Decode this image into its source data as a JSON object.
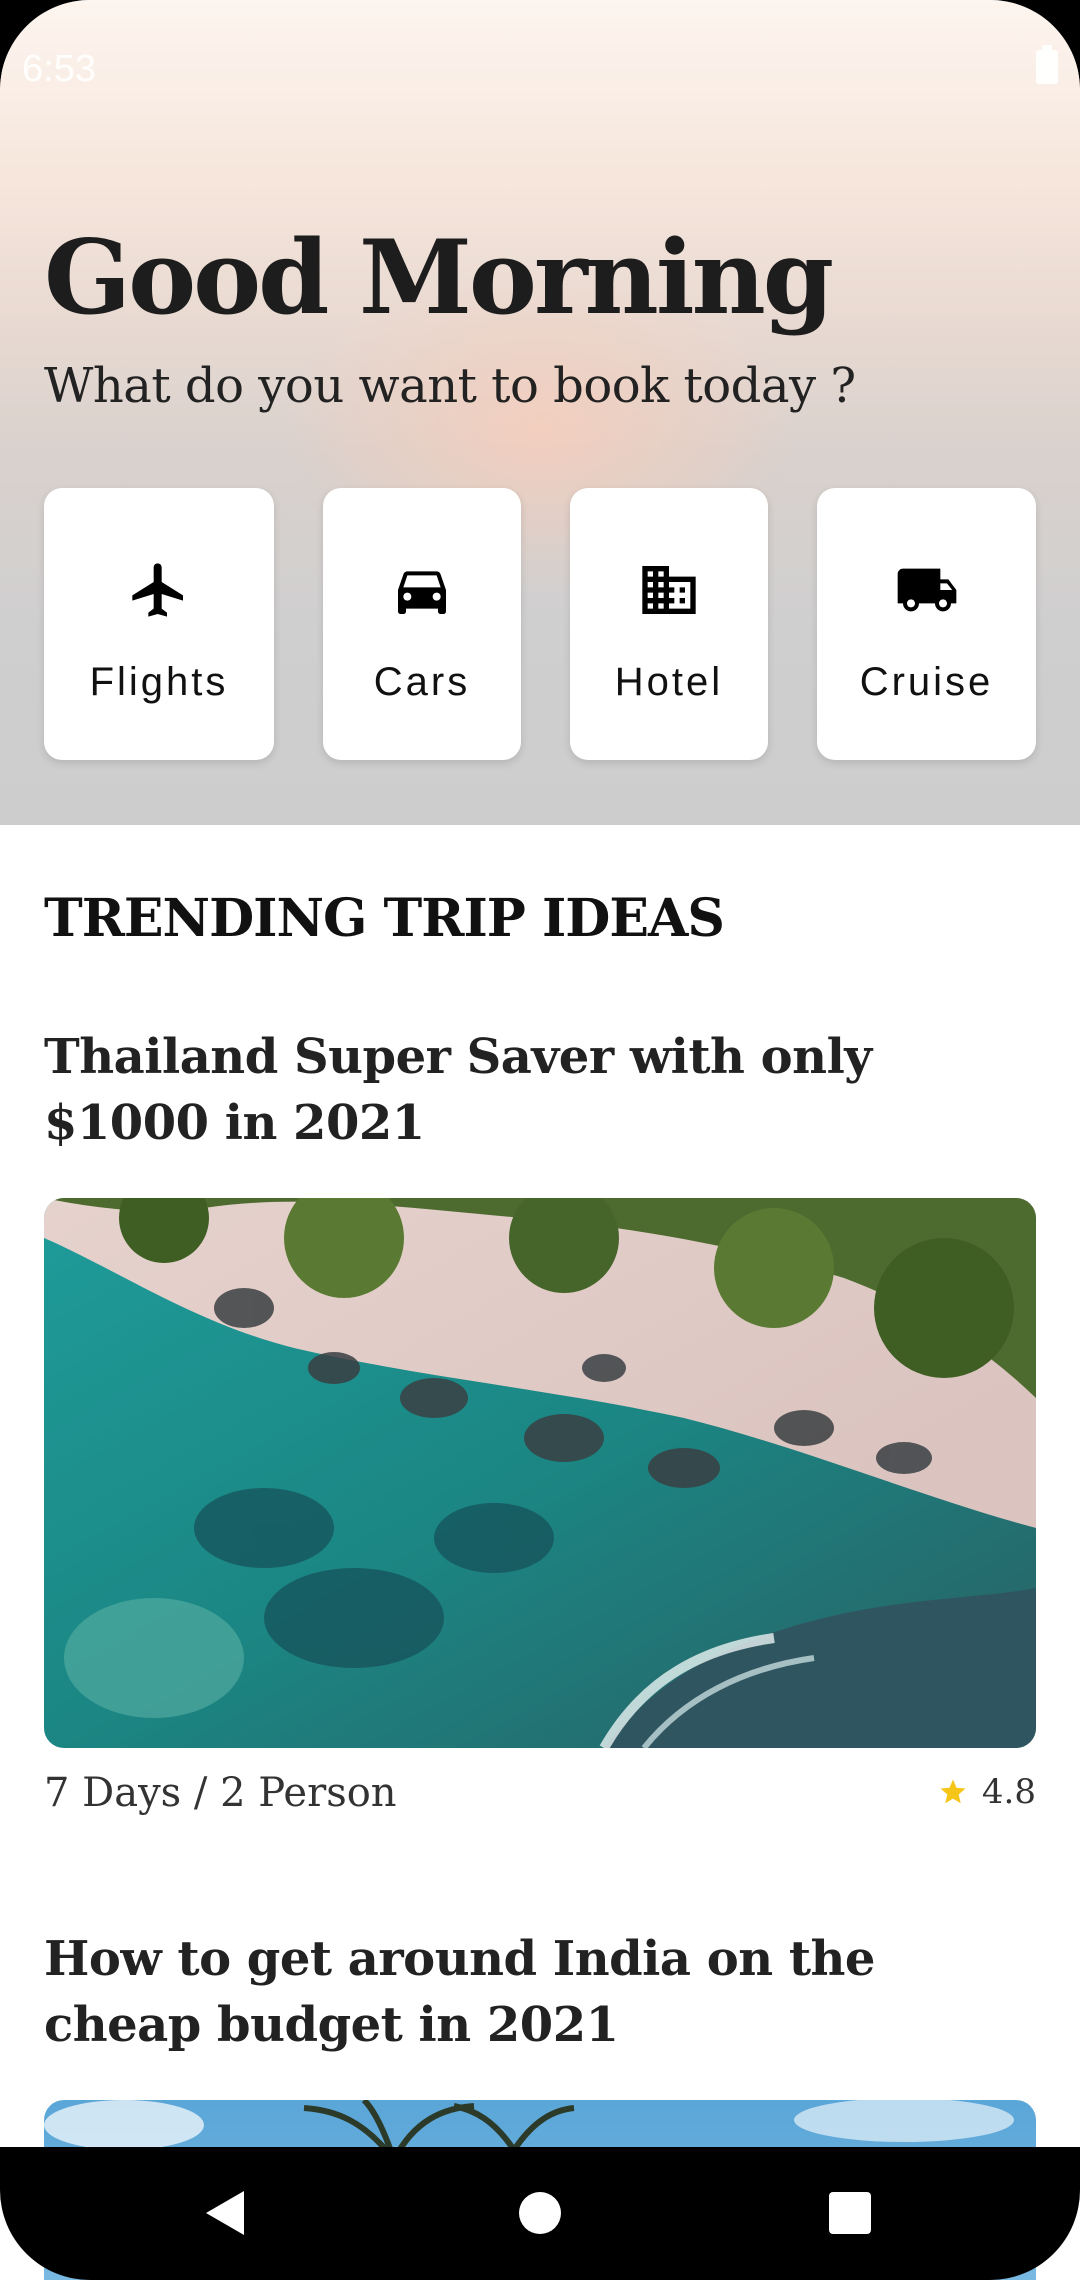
{
  "status_bar": {
    "time": "6:53"
  },
  "header": {
    "greeting": "Good Morning",
    "subtitle": "What do you want to book today ?"
  },
  "categories": [
    {
      "label": "Flights",
      "icon": "airplane-icon"
    },
    {
      "label": "Cars",
      "icon": "car-icon"
    },
    {
      "label": "Hotel",
      "icon": "building-icon"
    },
    {
      "label": "Cruise",
      "icon": "truck-icon"
    }
  ],
  "trending": {
    "section_title": "TRENDING TRIP IDEAS",
    "trips": [
      {
        "title": "Thailand Super Saver with only $1000 in 2021",
        "meta": "7 Days / 2 Person",
        "rating": "4.8",
        "image": "beach-aerial-image"
      },
      {
        "title": "How to get around India on the cheap budget in 2021",
        "image": "palm-trees-image"
      }
    ]
  },
  "nav_bar": {
    "buttons": [
      "back-icon",
      "home-icon",
      "recents-icon"
    ]
  },
  "colors": {
    "star": "#f5c518",
    "text_dark": "#1d1d1d",
    "card_bg": "#ffffff"
  }
}
